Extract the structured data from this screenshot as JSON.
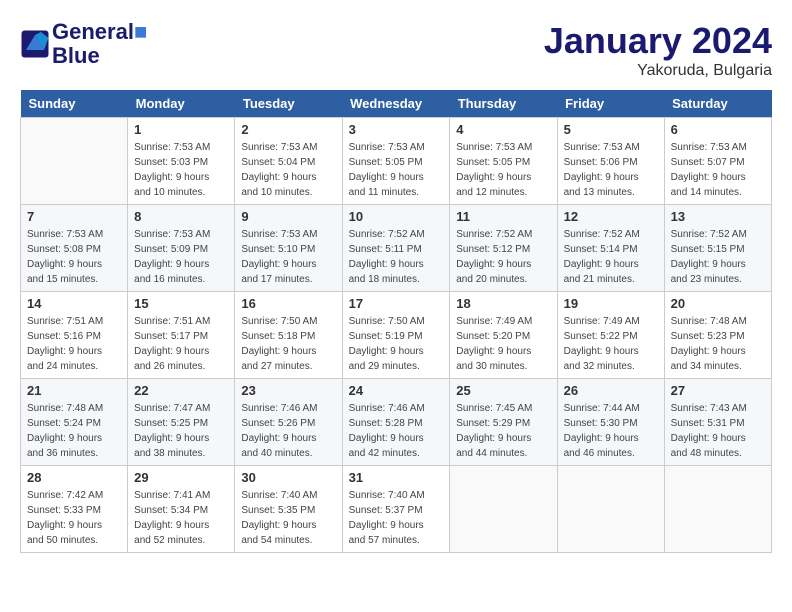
{
  "header": {
    "logo_line1": "General",
    "logo_line2": "Blue",
    "month_year": "January 2024",
    "location": "Yakoruda, Bulgaria"
  },
  "weekdays": [
    "Sunday",
    "Monday",
    "Tuesday",
    "Wednesday",
    "Thursday",
    "Friday",
    "Saturday"
  ],
  "weeks": [
    [
      {
        "num": "",
        "info": ""
      },
      {
        "num": "1",
        "info": "Sunrise: 7:53 AM\nSunset: 5:03 PM\nDaylight: 9 hours\nand 10 minutes."
      },
      {
        "num": "2",
        "info": "Sunrise: 7:53 AM\nSunset: 5:04 PM\nDaylight: 9 hours\nand 10 minutes."
      },
      {
        "num": "3",
        "info": "Sunrise: 7:53 AM\nSunset: 5:05 PM\nDaylight: 9 hours\nand 11 minutes."
      },
      {
        "num": "4",
        "info": "Sunrise: 7:53 AM\nSunset: 5:05 PM\nDaylight: 9 hours\nand 12 minutes."
      },
      {
        "num": "5",
        "info": "Sunrise: 7:53 AM\nSunset: 5:06 PM\nDaylight: 9 hours\nand 13 minutes."
      },
      {
        "num": "6",
        "info": "Sunrise: 7:53 AM\nSunset: 5:07 PM\nDaylight: 9 hours\nand 14 minutes."
      }
    ],
    [
      {
        "num": "7",
        "info": "Sunrise: 7:53 AM\nSunset: 5:08 PM\nDaylight: 9 hours\nand 15 minutes."
      },
      {
        "num": "8",
        "info": "Sunrise: 7:53 AM\nSunset: 5:09 PM\nDaylight: 9 hours\nand 16 minutes."
      },
      {
        "num": "9",
        "info": "Sunrise: 7:53 AM\nSunset: 5:10 PM\nDaylight: 9 hours\nand 17 minutes."
      },
      {
        "num": "10",
        "info": "Sunrise: 7:52 AM\nSunset: 5:11 PM\nDaylight: 9 hours\nand 18 minutes."
      },
      {
        "num": "11",
        "info": "Sunrise: 7:52 AM\nSunset: 5:12 PM\nDaylight: 9 hours\nand 20 minutes."
      },
      {
        "num": "12",
        "info": "Sunrise: 7:52 AM\nSunset: 5:14 PM\nDaylight: 9 hours\nand 21 minutes."
      },
      {
        "num": "13",
        "info": "Sunrise: 7:52 AM\nSunset: 5:15 PM\nDaylight: 9 hours\nand 23 minutes."
      }
    ],
    [
      {
        "num": "14",
        "info": "Sunrise: 7:51 AM\nSunset: 5:16 PM\nDaylight: 9 hours\nand 24 minutes."
      },
      {
        "num": "15",
        "info": "Sunrise: 7:51 AM\nSunset: 5:17 PM\nDaylight: 9 hours\nand 26 minutes."
      },
      {
        "num": "16",
        "info": "Sunrise: 7:50 AM\nSunset: 5:18 PM\nDaylight: 9 hours\nand 27 minutes."
      },
      {
        "num": "17",
        "info": "Sunrise: 7:50 AM\nSunset: 5:19 PM\nDaylight: 9 hours\nand 29 minutes."
      },
      {
        "num": "18",
        "info": "Sunrise: 7:49 AM\nSunset: 5:20 PM\nDaylight: 9 hours\nand 30 minutes."
      },
      {
        "num": "19",
        "info": "Sunrise: 7:49 AM\nSunset: 5:22 PM\nDaylight: 9 hours\nand 32 minutes."
      },
      {
        "num": "20",
        "info": "Sunrise: 7:48 AM\nSunset: 5:23 PM\nDaylight: 9 hours\nand 34 minutes."
      }
    ],
    [
      {
        "num": "21",
        "info": "Sunrise: 7:48 AM\nSunset: 5:24 PM\nDaylight: 9 hours\nand 36 minutes."
      },
      {
        "num": "22",
        "info": "Sunrise: 7:47 AM\nSunset: 5:25 PM\nDaylight: 9 hours\nand 38 minutes."
      },
      {
        "num": "23",
        "info": "Sunrise: 7:46 AM\nSunset: 5:26 PM\nDaylight: 9 hours\nand 40 minutes."
      },
      {
        "num": "24",
        "info": "Sunrise: 7:46 AM\nSunset: 5:28 PM\nDaylight: 9 hours\nand 42 minutes."
      },
      {
        "num": "25",
        "info": "Sunrise: 7:45 AM\nSunset: 5:29 PM\nDaylight: 9 hours\nand 44 minutes."
      },
      {
        "num": "26",
        "info": "Sunrise: 7:44 AM\nSunset: 5:30 PM\nDaylight: 9 hours\nand 46 minutes."
      },
      {
        "num": "27",
        "info": "Sunrise: 7:43 AM\nSunset: 5:31 PM\nDaylight: 9 hours\nand 48 minutes."
      }
    ],
    [
      {
        "num": "28",
        "info": "Sunrise: 7:42 AM\nSunset: 5:33 PM\nDaylight: 9 hours\nand 50 minutes."
      },
      {
        "num": "29",
        "info": "Sunrise: 7:41 AM\nSunset: 5:34 PM\nDaylight: 9 hours\nand 52 minutes."
      },
      {
        "num": "30",
        "info": "Sunrise: 7:40 AM\nSunset: 5:35 PM\nDaylight: 9 hours\nand 54 minutes."
      },
      {
        "num": "31",
        "info": "Sunrise: 7:40 AM\nSunset: 5:37 PM\nDaylight: 9 hours\nand 57 minutes."
      },
      {
        "num": "",
        "info": ""
      },
      {
        "num": "",
        "info": ""
      },
      {
        "num": "",
        "info": ""
      }
    ]
  ]
}
